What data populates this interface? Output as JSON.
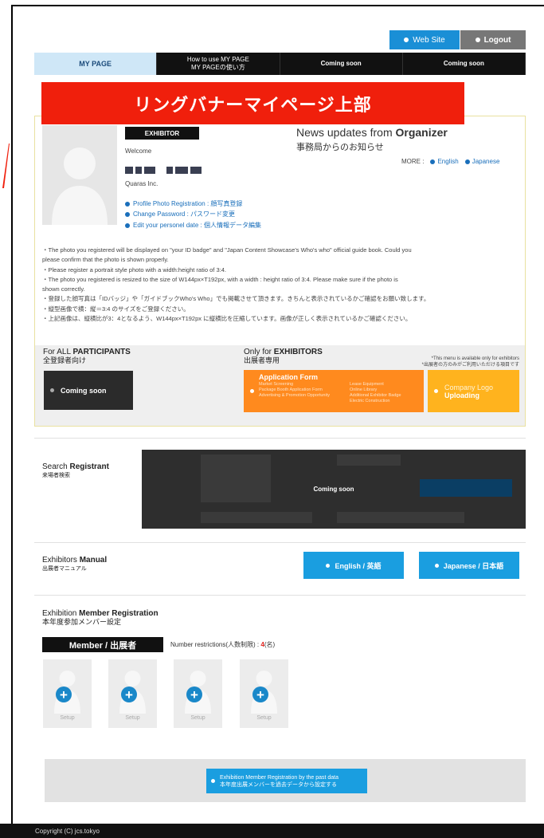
{
  "colors": {
    "accent": "#1a9ee0",
    "banner": "#f01f0c",
    "orange": "#ff8a1e",
    "amber": "#ffb31e",
    "nav": "#111111"
  },
  "top_buttons": {
    "web_site": "Web Site",
    "logout": "Logout"
  },
  "nav": [
    {
      "line1": "MY PAGE",
      "line2": ""
    },
    {
      "line1": "How to use MY PAGE",
      "line2": "MY PAGEの使い方"
    },
    {
      "line1": "Coming soon",
      "line2": ""
    },
    {
      "line1": "Coming soon",
      "line2": ""
    }
  ],
  "banner": "リングバナーマイページ上部",
  "profile": {
    "tag": "EXHIBITOR",
    "welcome": "Welcome",
    "company": "Quaras Inc.",
    "links": [
      "Profile Photo Registration : 顔写真登録",
      "Change Password : パスワード変更",
      "Edit your personel date : 個人情報データ編集"
    ]
  },
  "news": {
    "title_prefix": "News updates from ",
    "title_bold": "Organizer",
    "subtitle": "事務局からのお知らせ",
    "more_label": "MORE :",
    "english": "English",
    "japanese": "Japanese"
  },
  "notes": [
    "・The photo you registered will be displayed on \"your ID badge\" and \"Japan Content Showcase's Who's who\" official guide book. Could you",
    "  please confirm that the photo is shown properly.",
    "・Please register a portrait style photo with a width:height ratio of 3:4.",
    "・The photo you registered is resized to the size of W144px×T192px, with a width : height ratio of 3:4. Please make sure if the photo is",
    "  shown correctly.",
    "・登録した顔写真は「IDバッジ」や「ガイドブックWho's Who」でも掲載させて頂きます。きちんと表示されているかご確認をお願い致します。",
    "・縦型画像で横：縦＝3:4 のサイズをご登録ください。",
    "・上記画像は、縦横比が3：4となるよう、W144px×T192px に縦横比を圧縮しています。画像が正しく表示されているかご確認ください。"
  ],
  "participants": {
    "prefix": "For ALL ",
    "bold": "PARTICIPANTS",
    "jp": "全登録者向け",
    "button": "Coming soon"
  },
  "exhibitors": {
    "prefix": "Only for ",
    "bold": "EXHIBITORS",
    "jp": "出展者専用",
    "note1": "*This menu is available only for exhibitors",
    "note2": "*出展者の方のみがご利用いただける項目です",
    "app_form_prefix": "Application ",
    "app_form_bold": "Form",
    "items_left": [
      "Market Screening",
      "Package Booth Application Form",
      "Advertising & Promotion Opportunity"
    ],
    "items_right": [
      "Lease Equipment",
      "Online Library",
      "Additional Exhibitor Badge",
      "Electric Construction"
    ],
    "logo_line1": "Company Logo",
    "logo_line2": "Uploading"
  },
  "search": {
    "title_prefix": "Search ",
    "title_bold": "Registrant",
    "jp": "来場者検索",
    "coming_soon": "Coming soon"
  },
  "manual": {
    "title_prefix": "Exhibitors ",
    "title_bold": "Manual",
    "jp": "出展者マニュアル",
    "english": "English / 英語",
    "japanese": "Japanese / 日本語"
  },
  "registration": {
    "title_prefix": "Exhibition ",
    "title_bold": "Member Registration",
    "jp": "本年度参加メンバー設定",
    "member_tag": "Member / 出展者",
    "restriction_label": "Number restrictions(人数制限) : ",
    "restriction_num": "4",
    "restriction_unit": "(名)",
    "slot_label": "Setup",
    "past_line1": "Exhibition Member Registration by the past data",
    "past_line2": "本年度出展メンバーを過去データから設定する"
  },
  "footer": "Copyright (C) jcs.tokyo"
}
